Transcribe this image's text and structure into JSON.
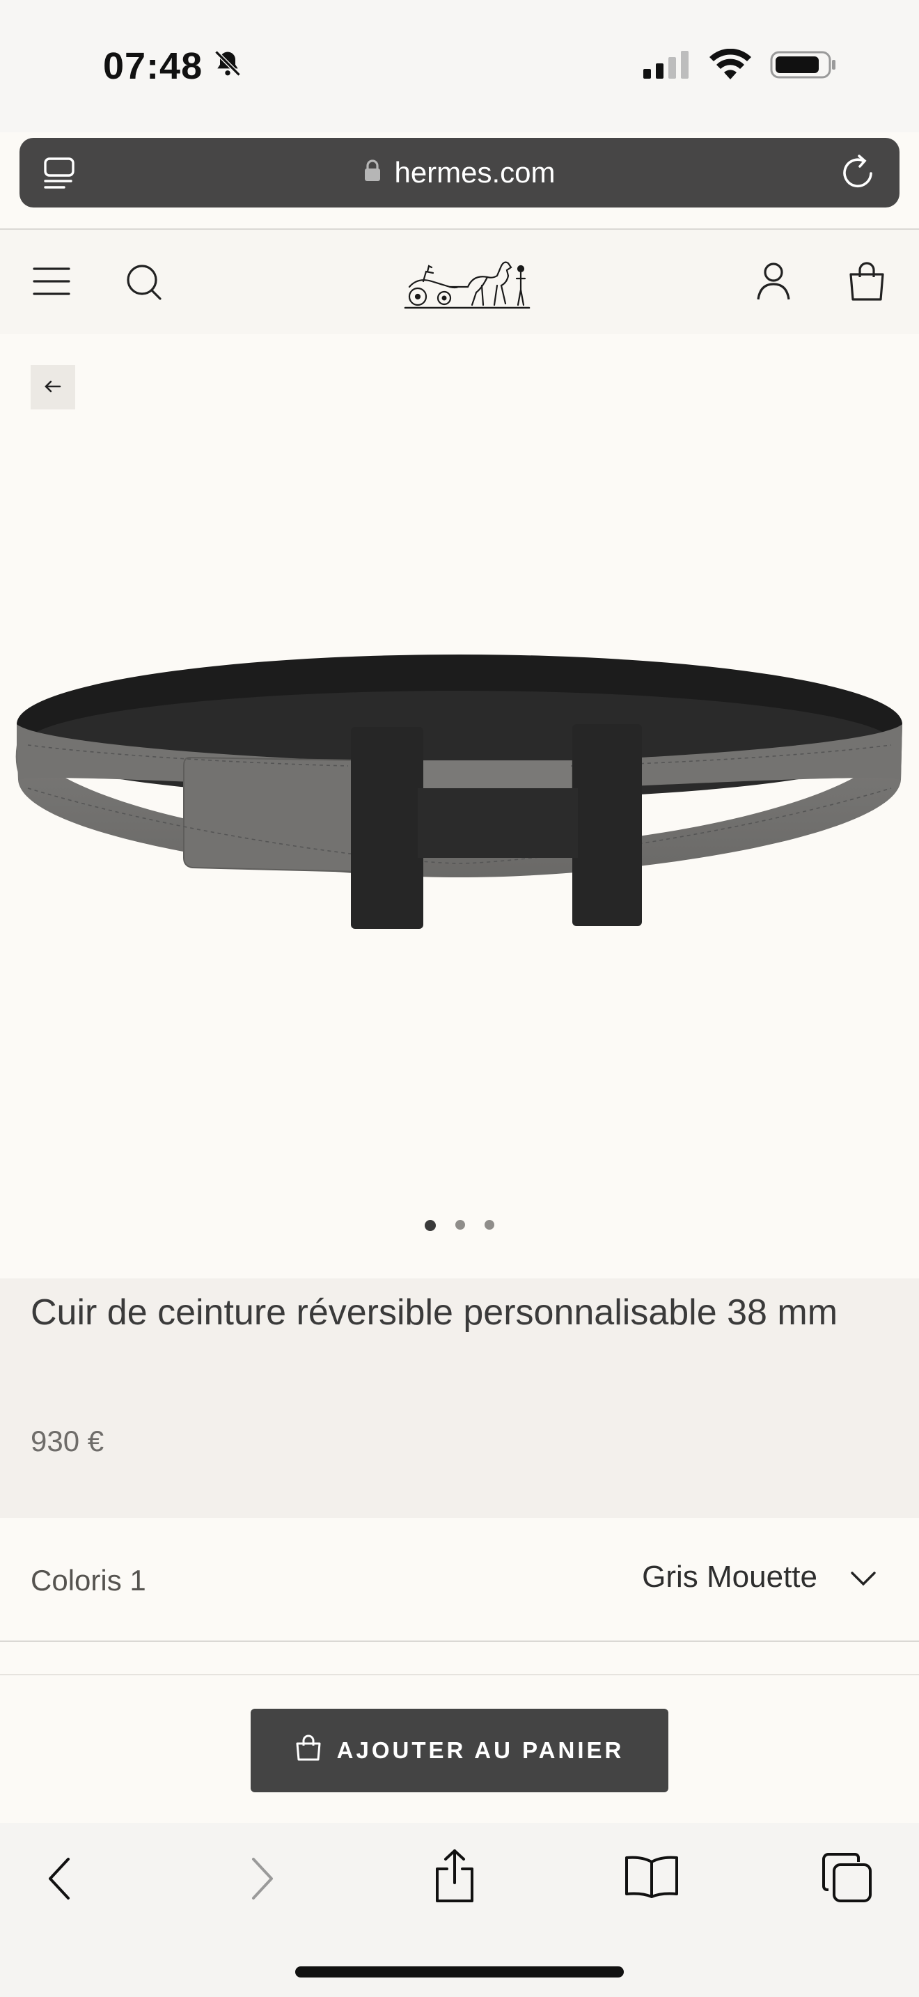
{
  "status_bar": {
    "time": "07:48",
    "icons": [
      "bell-slash-icon",
      "cellular-signal-icon",
      "wifi-icon",
      "battery-icon"
    ]
  },
  "browser": {
    "url_domain": "hermes.com",
    "icons": [
      "reader-icon",
      "lock-icon",
      "reload-icon"
    ],
    "toolbar_icons": [
      "back-arrow-icon",
      "forward-arrow-icon",
      "share-icon",
      "bookmarks-icon",
      "tabs-icon"
    ]
  },
  "header": {
    "icons": [
      "menu-icon",
      "search-icon",
      "hermes-logo",
      "account-icon",
      "bag-icon"
    ]
  },
  "gallery": {
    "back_icon": "arrow-left-icon",
    "slide_count": 3,
    "active_slide": 1
  },
  "product": {
    "title": "Cuir de ceinture réversible personnalisable 38 mm",
    "price": "930 €"
  },
  "options": {
    "color_label": "Coloris 1",
    "color_value": "Gris Mouette"
  },
  "cart": {
    "label": "AJOUTER AU PANIER"
  },
  "colors": {
    "page_bg": "#fcfaf6",
    "panel_bg": "#f3f0ec",
    "url_bar": "#474646",
    "button": "#444444"
  }
}
